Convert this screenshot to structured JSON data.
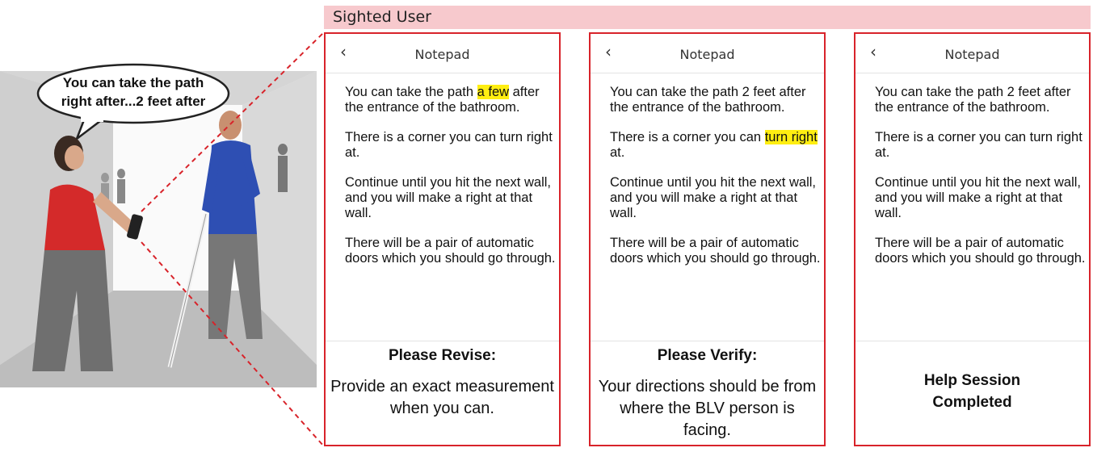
{
  "header": {
    "title": "Sighted User"
  },
  "illustration": {
    "speech_line1": "You can take the path",
    "speech_line2": "right after...2 feet after"
  },
  "panels": [
    {
      "app_title": "Notepad",
      "back": "‹",
      "p1_pre": "You can take the  path ",
      "p1_hl": "a few",
      "p1_post": " after the entrance of the bathroom.",
      "p2_pre": "There is a corner you can turn right at.",
      "p2_hl": "",
      "p2_post": "",
      "p3": "Continue until you hit the next wall, and you will make a right at that wall.",
      "p4": "There will be a pair of automatic doors which you should go through.",
      "footer_head": "Please Revise:",
      "footer_body": "Provide an exact measurement when you can."
    },
    {
      "app_title": "Notepad",
      "back": "‹",
      "p1_pre": "You can take the path 2 feet after the entrance of the bathroom.",
      "p1_hl": "",
      "p1_post": "",
      "p2_pre": "There is a corner you can ",
      "p2_hl": "turn right ",
      "p2_post": " at.",
      "p3": "Continue until you hit the next wall, and you will make a right at that wall.",
      "p4": "There will be a pair of automatic doors which you should go through.",
      "footer_head": "Please Verify:",
      "footer_body": "Your directions should be from where the BLV person is facing."
    },
    {
      "app_title": "Notepad",
      "back": "‹",
      "p1_pre": "You can take the path 2 feet after the entrance of the bathroom.",
      "p1_hl": "",
      "p1_post": "",
      "p2_pre": "There is a corner you can turn right at.",
      "p2_hl": "",
      "p2_post": "",
      "p3": "Continue until you hit the next wall, and you will make a right at that wall.",
      "p4": "There will be a pair of automatic doors which you should go through.",
      "footer_done_line1": "Help Session",
      "footer_done_line2": "Completed"
    }
  ],
  "colors": {
    "accent": "#d8232a",
    "header_band": "#f7c9cd",
    "highlight": "#ffee11"
  }
}
